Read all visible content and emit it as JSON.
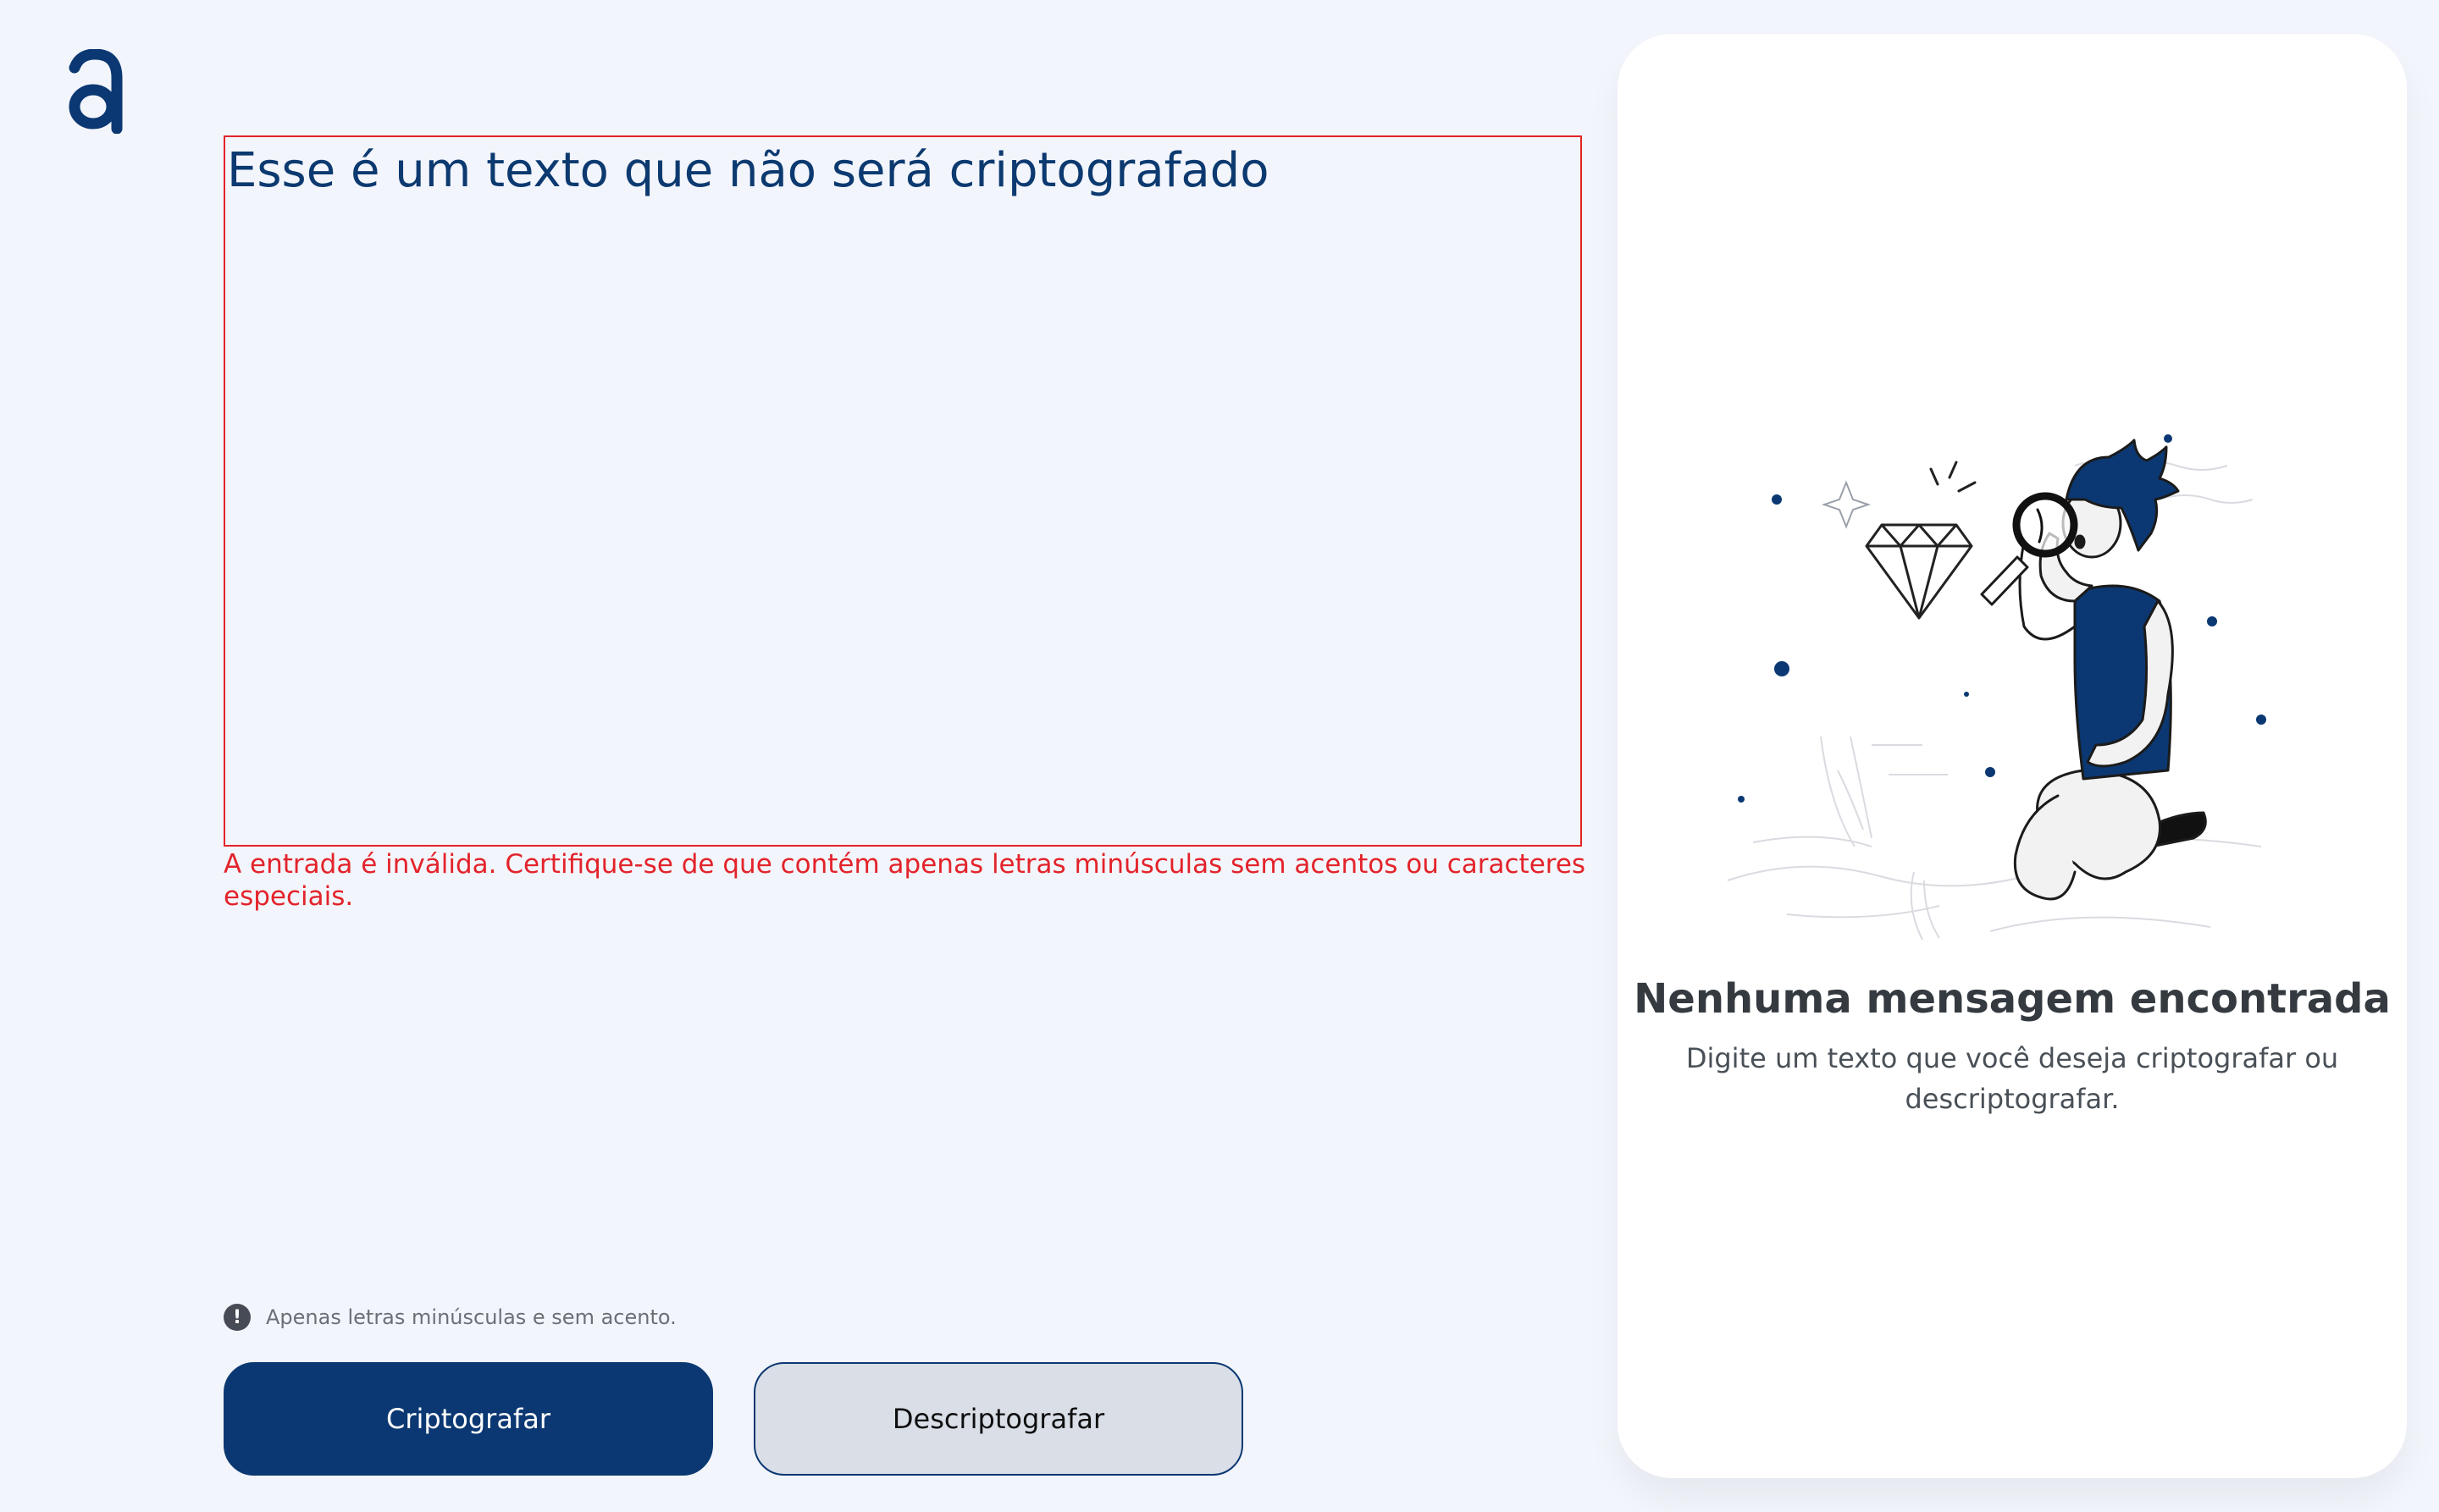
{
  "logo": {
    "glyph": "a",
    "color": "#0b3872"
  },
  "input": {
    "value": "Esse é um texto que não será criptografado",
    "error": "A entrada é inválida. Certifique-se de que contém apenas letras minúsculas sem acentos ou caracteres especiais."
  },
  "hint": {
    "icon": "exclamation-circle-icon",
    "text": "Apenas letras minúsculas e sem acento."
  },
  "buttons": {
    "encrypt_label": "Criptografar",
    "decrypt_label": "Descriptografar"
  },
  "output": {
    "illustration": "person-with-magnifying-glass-diamond",
    "title": "Nenhuma mensagem encontrada",
    "text": "Digite um texto que você deseja criptografar ou descriptografar."
  },
  "colors": {
    "primary": "#0b3872",
    "error": "#e3232a",
    "background": "#f3f5fc",
    "panel": "#ffffff"
  }
}
